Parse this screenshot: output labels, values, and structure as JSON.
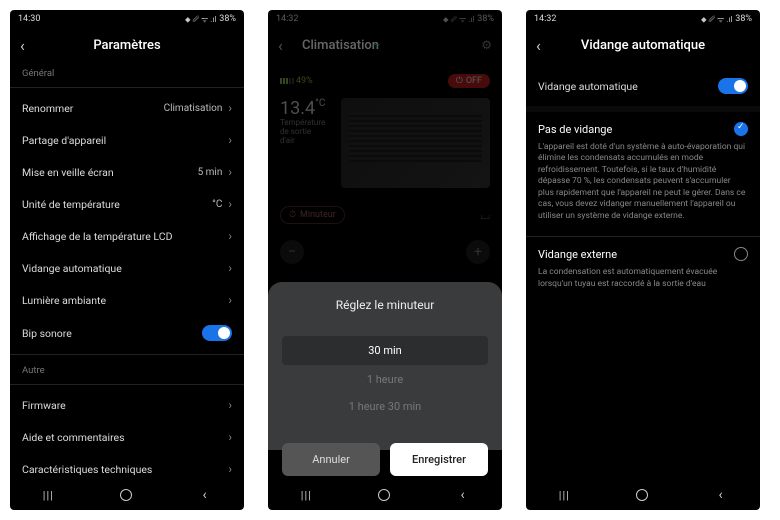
{
  "status": {
    "time1": "14:30",
    "time23": "14:32",
    "battery": "38%",
    "icons": "⬥ ␥ ᯤ .ıl"
  },
  "s1": {
    "title": "Paramètres",
    "sections": {
      "general": "Général",
      "other": "Autre"
    },
    "rows": {
      "rename": {
        "label": "Renommer",
        "value": "Climatisation"
      },
      "share": {
        "label": "Partage d'appareil"
      },
      "screen": {
        "label": "Mise en veille écran",
        "value": "5 min"
      },
      "unit": {
        "label": "Unité de température",
        "value": "°C"
      },
      "lcd": {
        "label": "Affichage de la température LCD"
      },
      "drain": {
        "label": "Vidange automatique"
      },
      "light": {
        "label": "Lumière ambiante"
      },
      "beep": {
        "label": "Bip sonore"
      },
      "firmware": {
        "label": "Firmware"
      },
      "help": {
        "label": "Aide et commentaires"
      },
      "specs": {
        "label": "Caractéristiques techniques"
      }
    }
  },
  "s2": {
    "title": "Climatisation",
    "battery_pct": "49%",
    "off": "OFF",
    "temp": "13.4",
    "temp_unit": "°C",
    "temp_caption": "Température de sortie d'air",
    "minuteur": "Minuteur",
    "sheet": {
      "title": "Réglez le minuteur",
      "options": [
        "30 min",
        "1 heure",
        "1 heure 30 min"
      ],
      "cancel": "Annuler",
      "save": "Enregistrer"
    }
  },
  "s3": {
    "title": "Vidange automatique",
    "toggle_label": "Vidange automatique",
    "opt1": {
      "title": "Pas de vidange",
      "desc": "L'appareil est doté d'un système à auto-évaporation qui élimine les condensats accumulés en mode refroidissement. Toutefois, si le taux d'humidité dépasse 70 %, les condensats peuvent s'accumuler plus rapidement que l'appareil ne peut le gérer. Dans ce cas, vous devez vidanger manuellement l'appareil ou utiliser un système de vidange externe."
    },
    "opt2": {
      "title": "Vidange externe",
      "desc": "La condensation est automatiquement évacuée lorsqu'un tuyau est raccordé à la sortie d'eau"
    }
  }
}
